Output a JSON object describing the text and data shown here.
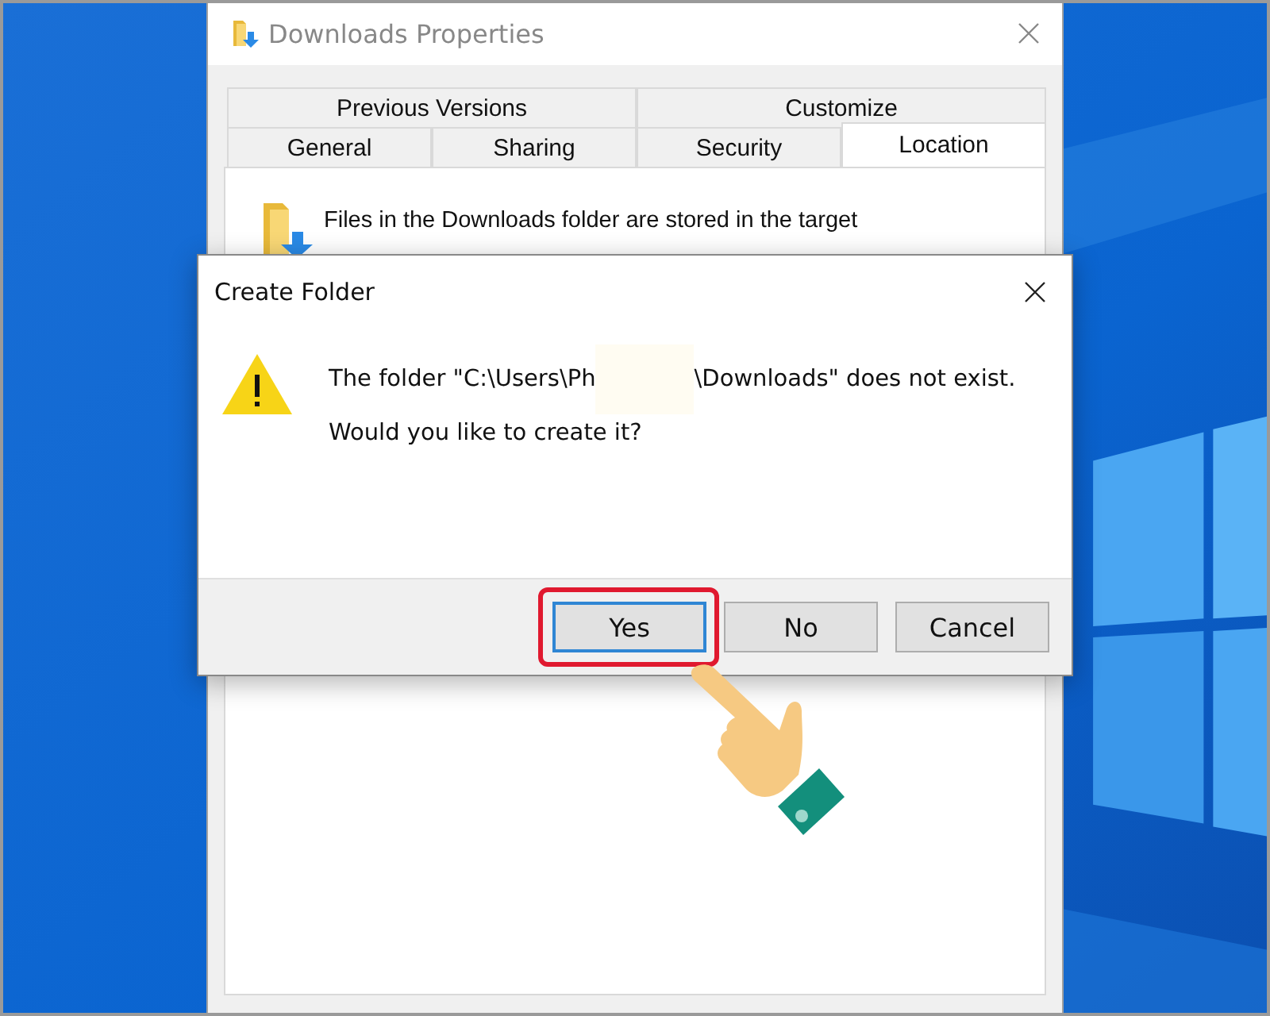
{
  "properties_window": {
    "title": "Downloads Properties",
    "tabs_row_1": [
      {
        "label": "Previous Versions",
        "selected": false
      },
      {
        "label": "Customize",
        "selected": false
      }
    ],
    "tabs_row_2": [
      {
        "label": "General",
        "selected": false
      },
      {
        "label": "Sharing",
        "selected": false
      },
      {
        "label": "Security",
        "selected": false
      },
      {
        "label": "Location",
        "selected": true
      }
    ],
    "description": "Files in the Downloads folder are stored in the target"
  },
  "dialog": {
    "title": "Create Folder",
    "message_start": "The folder \"C:\\Users\\Ph",
    "message_end": "\\Downloads\" does not exist.",
    "question": "Would you like to create it?",
    "buttons": [
      {
        "label": "Yes",
        "selected": true,
        "highlighted": true
      },
      {
        "label": "No",
        "selected": false,
        "highlighted": false
      },
      {
        "label": "Cancel",
        "selected": false,
        "highlighted": false
      }
    ]
  }
}
